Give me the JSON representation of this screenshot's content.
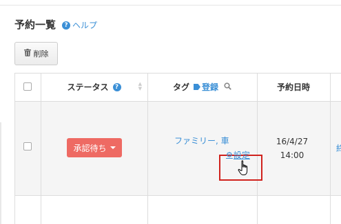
{
  "page": {
    "title": "予約一覧",
    "help_label": "ヘルプ",
    "help_glyph": "?"
  },
  "toolbar": {
    "delete_label": "削除",
    "delete_icon": "trash-icon"
  },
  "table": {
    "columns": [
      {
        "key": "select",
        "label": ""
      },
      {
        "key": "status",
        "label": "ステータス",
        "help_glyph": "?"
      },
      {
        "key": "tag",
        "label": "タグ",
        "register_label": "登録",
        "search_glyph": "🔍"
      },
      {
        "key": "reserved_at",
        "label": "予約日時"
      }
    ],
    "rows": [
      {
        "status": "承認待ち",
        "tags": "ファミリー, 車",
        "tag_settings_label": "設定",
        "date": "16/4/27",
        "time": "14:00",
        "next_col_partial": "終"
      }
    ]
  },
  "colors": {
    "accent": "#3a8fd6",
    "status_pending": "#ee6a63",
    "highlight": "#d0211c"
  }
}
